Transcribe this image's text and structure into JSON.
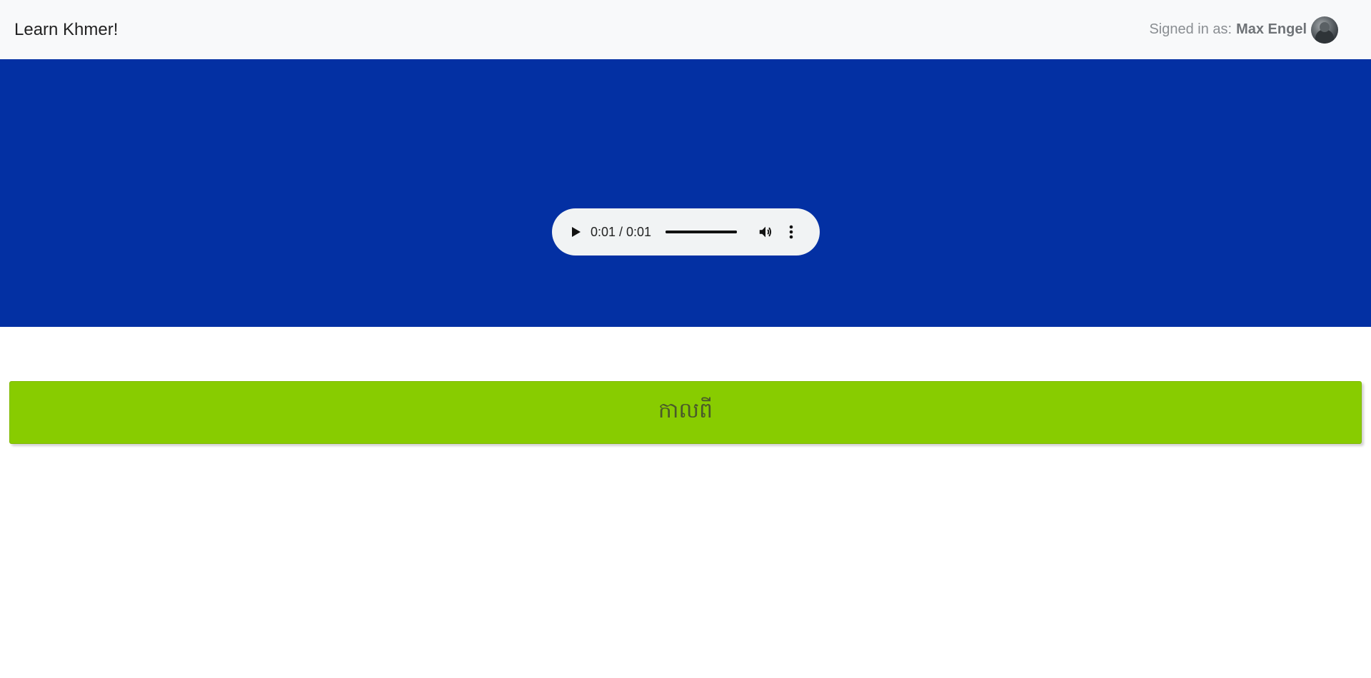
{
  "header": {
    "brand": "Learn Khmer!",
    "signed_in_prefix": "Signed in as:",
    "user_name": "Max Engel"
  },
  "audio": {
    "time_display": "0:01 / 0:01",
    "progress": 1.0,
    "play_icon": "play-icon",
    "volume_icon": "volume-icon",
    "more_icon": "more-vert-icon"
  },
  "colors": {
    "hero_background": "#0330a3",
    "answer_background": "#88cc00",
    "navbar_background": "#f8f9fa"
  },
  "answer": {
    "label": "កាលពី"
  }
}
